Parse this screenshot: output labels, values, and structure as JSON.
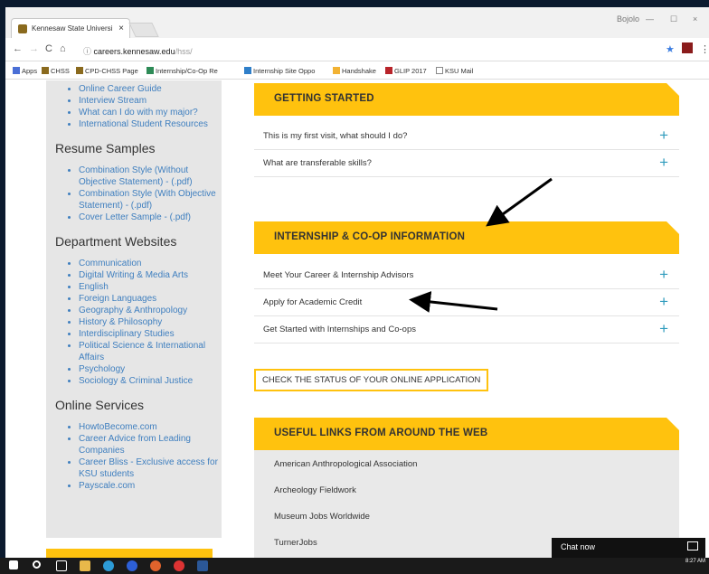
{
  "browser": {
    "tab_title": "Kennesaw State Universi",
    "tab_close": "×",
    "user": "Bojolo",
    "min": "—",
    "max": "☐",
    "close": "×",
    "url_host": "careers.kennesaw.edu",
    "url_path": "/hss/",
    "bookmarks": [
      "Apps",
      "CHSS",
      "CPD-CHSS Page",
      "Internship/Co-Op Re",
      "Internship Site Oppo",
      "Handshake",
      "GLIP 2017",
      "KSU Mail"
    ]
  },
  "sidebar": {
    "top_items": [
      "Online Career Guide",
      "Interview Stream",
      "What can I do with my major?",
      "International Student Resources"
    ],
    "resume": {
      "heading": "Resume Samples",
      "items": [
        "Combination Style (Without Objective Statement) - (.pdf)",
        "Combination Style (With Objective Statement) - (.pdf)",
        "Cover Letter Sample - (.pdf)"
      ]
    },
    "dept": {
      "heading": "Department Websites",
      "items": [
        "Communication",
        "Digital Writing & Media Arts",
        "English",
        "Foreign Languages",
        "Geography & Anthropology",
        "History & Philosophy",
        "Interdisciplinary Studies",
        "Political Science & International Affairs",
        "Psychology",
        "Sociology & Criminal Justice"
      ]
    },
    "online": {
      "heading": "Online Services",
      "items": [
        "HowtoBecome.com",
        "Career Advice from Leading Companies",
        "Career Bliss - Exclusive access for KSU students",
        "Payscale.com"
      ]
    }
  },
  "main": {
    "getting_started": {
      "title": "GETTING STARTED",
      "rows": [
        "This is my first visit, what should I do?",
        "What are transferable skills?"
      ]
    },
    "internship": {
      "title": "INTERNSHIP & CO-OP INFORMATION",
      "rows": [
        "Meet Your Career & Internship Advisors",
        "Apply for Academic Credit",
        "Get Started with Internships and Co-ops"
      ]
    },
    "status_button": "CHECK THE STATUS OF YOUR ONLINE APPLICATION",
    "useful": {
      "title": "USEFUL LINKS FROM AROUND THE WEB",
      "links": [
        "American Anthropological Association",
        "Archeology Fieldwork",
        "Museum Jobs Worldwide",
        "TurnerJobs"
      ]
    }
  },
  "plus": "+",
  "chat": "Chat now",
  "clock": "8:27 AM",
  "colors": {
    "accent": "#ffc20e",
    "link": "#3f7fbf",
    "plus": "#2e9bbd"
  }
}
